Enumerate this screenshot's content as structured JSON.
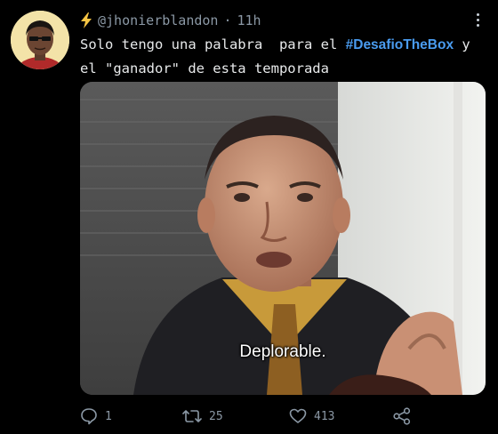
{
  "tweet": {
    "author_handle": "@jhonierblandon",
    "separator": "·",
    "time": "11h",
    "text_before": "Solo tengo una palabra  para el ",
    "hashtag": "#DesafioTheBox",
    "text_after": " y el \"ganador\" de esta temporada",
    "media_caption": "Deplorable.",
    "replies": "1",
    "retweets": "25",
    "likes": "413"
  },
  "icons": {
    "author_badge": "lightning-bolt-icon",
    "menu": "more-vertical-icon",
    "reply": "reply-icon",
    "retweet": "retweet-icon",
    "like": "heart-icon",
    "share": "share-icon"
  },
  "colors": {
    "background": "#000000",
    "hashtag": "#4a9cf0",
    "muted": "#8b98a5",
    "bolt": "#f6c544"
  }
}
